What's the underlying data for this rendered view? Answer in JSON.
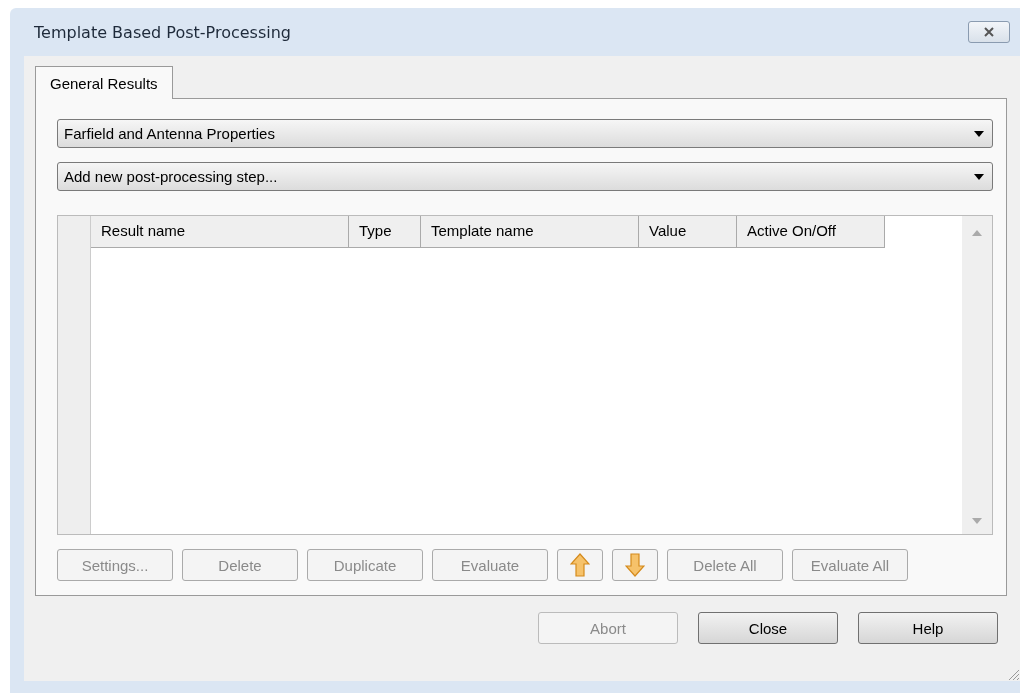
{
  "window": {
    "title": "Template Based Post-Processing"
  },
  "tabs": [
    {
      "label": "General Results",
      "selected": true
    }
  ],
  "dropdowns": [
    {
      "value": "Farfield and Antenna Properties"
    },
    {
      "value": "Add new post-processing step..."
    }
  ],
  "table": {
    "columns": [
      "Result name",
      "Type",
      "Template name",
      "Value",
      "Active On/Off"
    ]
  },
  "toolbar_buttons": [
    {
      "kind": "text",
      "label": "Settings...",
      "disabled": true
    },
    {
      "kind": "text",
      "label": "Delete",
      "disabled": true
    },
    {
      "kind": "text",
      "label": "Duplicate",
      "disabled": true
    },
    {
      "kind": "text",
      "label": "Evaluate",
      "disabled": true
    },
    {
      "kind": "arrow-up"
    },
    {
      "kind": "arrow-down"
    },
    {
      "kind": "text",
      "label": "Delete All",
      "disabled": true
    },
    {
      "kind": "text",
      "label": "Evaluate All",
      "disabled": true
    }
  ],
  "dialog_buttons": [
    {
      "label": "Abort",
      "disabled": true
    },
    {
      "label": "Close",
      "disabled": false
    },
    {
      "label": "Help",
      "disabled": false
    }
  ]
}
